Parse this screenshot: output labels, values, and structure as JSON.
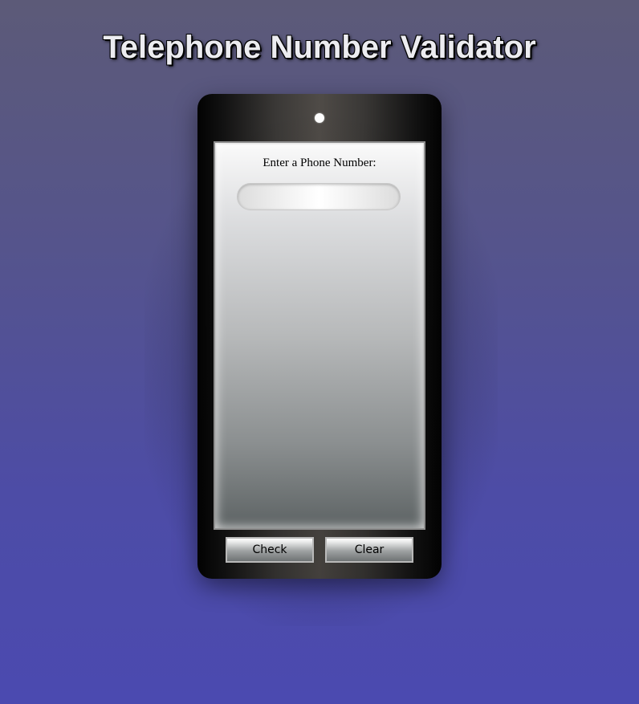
{
  "header": {
    "title": "Telephone Number Validator"
  },
  "phone": {
    "prompt_label": "Enter a Phone Number:",
    "input_value": "",
    "input_placeholder": "",
    "results": []
  },
  "buttons": {
    "check_label": "Check",
    "clear_label": "Clear"
  },
  "colors": {
    "background_top": "#5c5a78",
    "background_bottom": "#4b4ab0",
    "title_text": "#ececf0",
    "phone_body": "#111111",
    "camera": "#ffffff"
  }
}
